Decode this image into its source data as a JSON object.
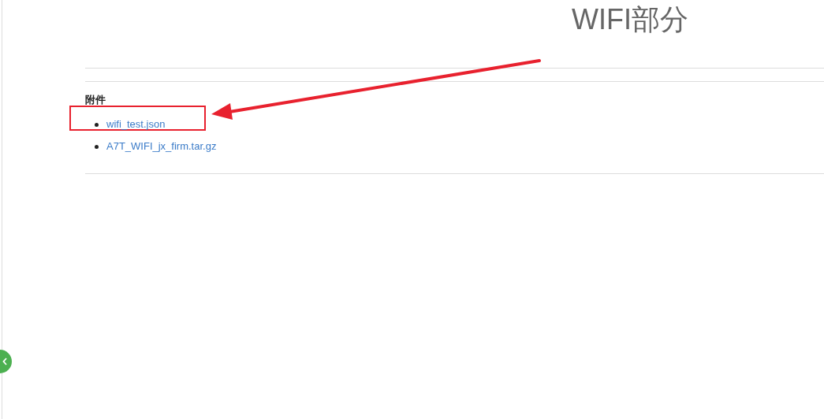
{
  "annotation": {
    "title": "WIFI部分"
  },
  "attachments": {
    "heading": "附件",
    "files": [
      {
        "name": "wifi_test.json",
        "highlighted": true
      },
      {
        "name": "A7T_WIFI_jx_firm.tar.gz",
        "highlighted": false
      }
    ]
  }
}
